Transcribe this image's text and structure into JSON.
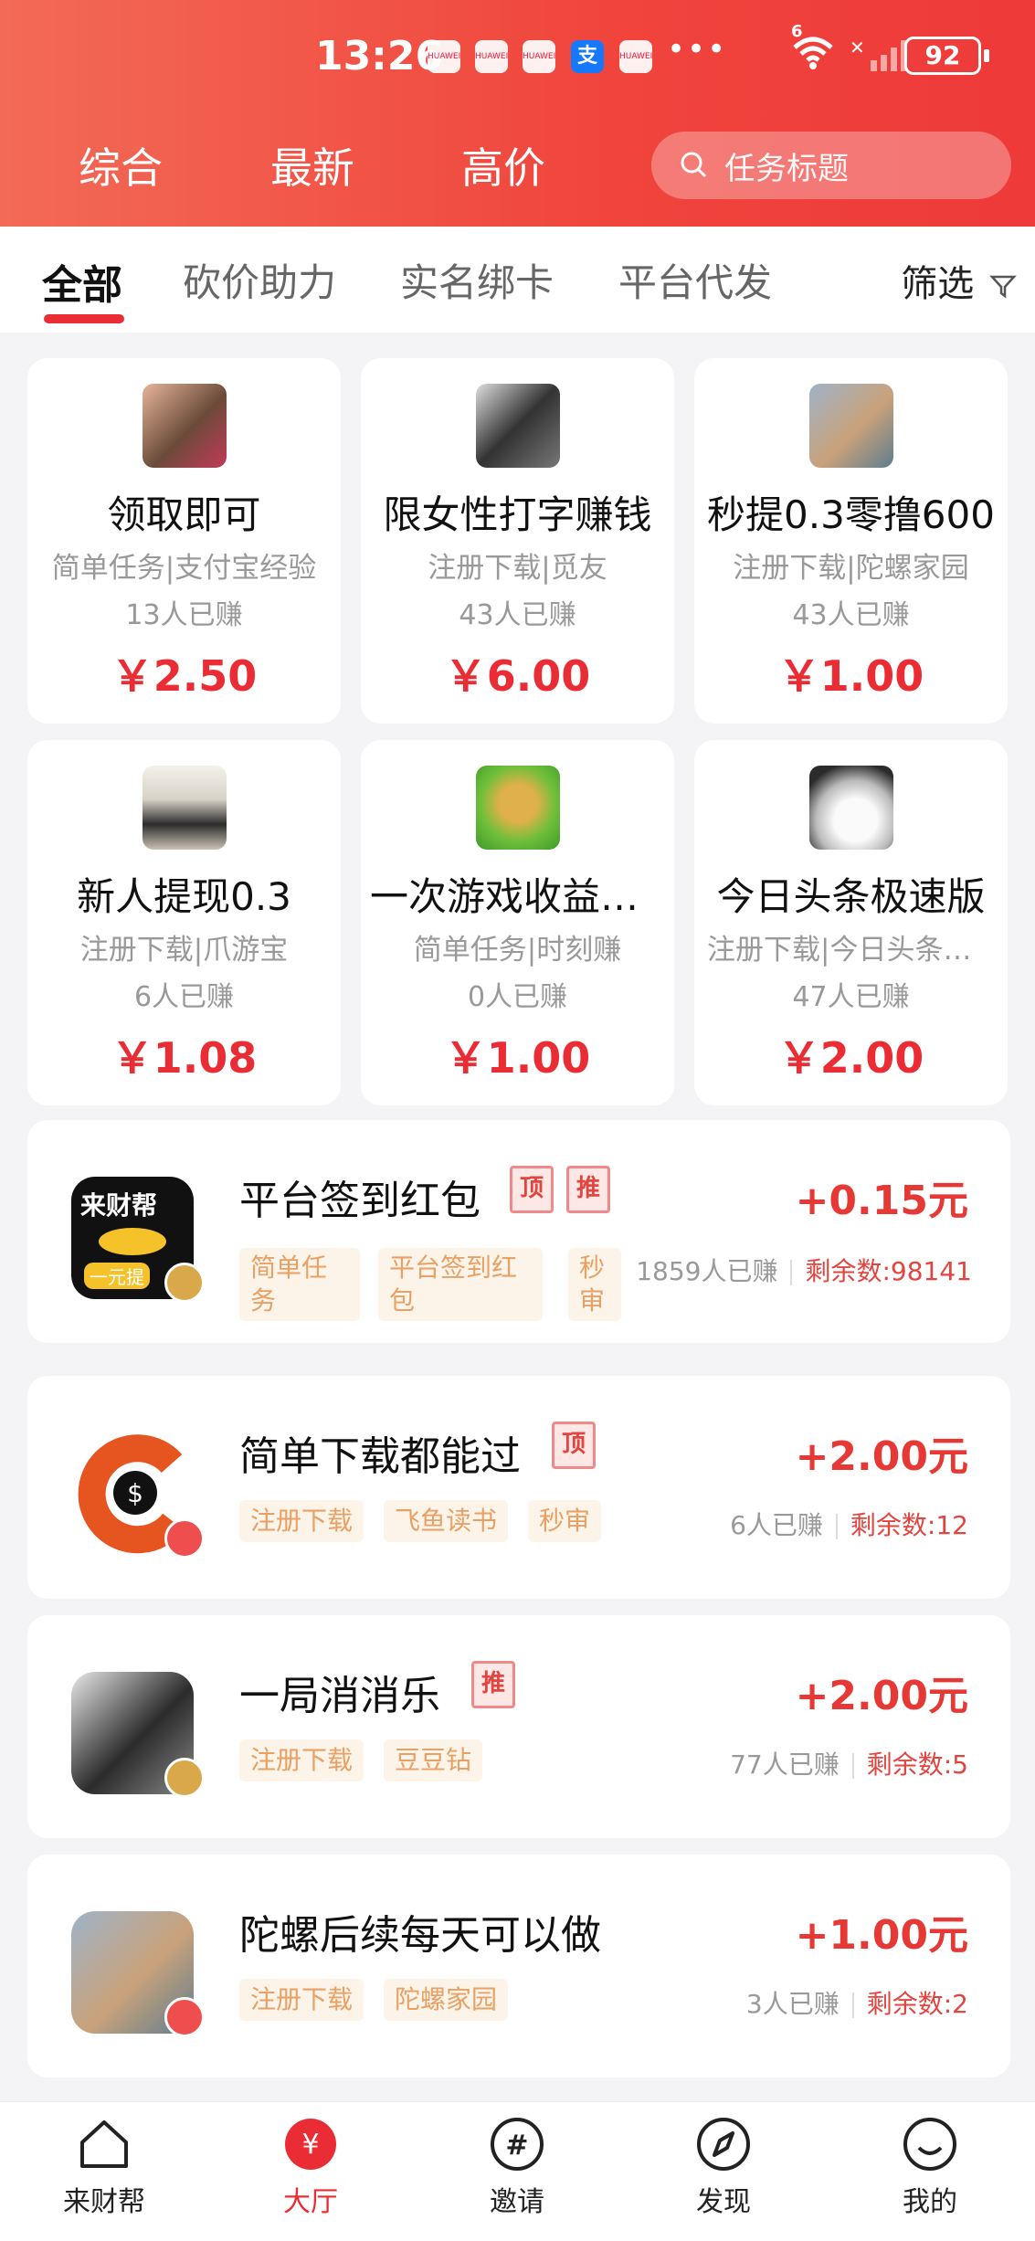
{
  "status_bar": {
    "time": "13:26",
    "battery": "92",
    "network": "6"
  },
  "top_tabs": [
    "综合",
    "最新",
    "高价"
  ],
  "search": {
    "placeholder": "任务标题"
  },
  "categories": [
    "全部",
    "砍价助力",
    "实名绑卡",
    "平台代发"
  ],
  "filter_label": "筛选",
  "grid_tasks": [
    {
      "title": "领取即可",
      "subtitle": "简单任务|支付宝经验",
      "count": "13人已赚",
      "price": "￥2.50"
    },
    {
      "title": "限女性打字赚钱",
      "subtitle": "注册下载|觅友",
      "count": "43人已赚",
      "price": "￥6.00"
    },
    {
      "title": "秒提0.3零撸600",
      "subtitle": "注册下载|陀螺家园",
      "count": "43人已赚",
      "price": "￥1.00"
    },
    {
      "title": "新人提现0.3",
      "subtitle": "注册下载|爪游宝",
      "count": "6人已赚",
      "price": "￥1.08"
    },
    {
      "title": "一次游戏收益百元",
      "subtitle": "简单任务|时刻赚",
      "count": "0人已赚",
      "price": "￥1.00"
    },
    {
      "title": "今日头条极速版",
      "subtitle": "注册下载|今日头条极速版",
      "count": "47人已赚",
      "price": "￥2.00"
    }
  ],
  "list_tasks": [
    {
      "title": "平台签到红包",
      "marks": [
        "顶",
        "推"
      ],
      "tags": [
        "简单任务",
        "平台签到红包",
        "秒审"
      ],
      "price": "+0.15元",
      "earned": "1859人已赚",
      "remaining": "剩余数:98141",
      "logo_text": "来财帮",
      "logo_sub": "一元提"
    },
    {
      "title": "简单下载都能过",
      "marks": [
        "顶"
      ],
      "tags": [
        "注册下载",
        "飞鱼读书",
        "秒审"
      ],
      "price": "+2.00元",
      "earned": "6人已赚",
      "remaining": "剩余数:12"
    },
    {
      "title": "一局消消乐",
      "marks": [
        "推"
      ],
      "tags": [
        "注册下载",
        "豆豆钻"
      ],
      "price": "+2.00元",
      "earned": "77人已赚",
      "remaining": "剩余数:5"
    },
    {
      "title": "陀螺后续每天可以做",
      "marks": [],
      "tags": [
        "注册下载",
        "陀螺家园"
      ],
      "price": "+1.00元",
      "earned": "3人已赚",
      "remaining": "剩余数:2"
    }
  ],
  "bottom_nav": [
    "来财帮",
    "大厅",
    "邀请",
    "发现",
    "我的"
  ],
  "colors": {
    "accent": "#ea2d34",
    "header_start": "#f36a56",
    "header_end": "#ee3a39",
    "tag_bg": "#fdf4e9",
    "tag_text": "#e8a064"
  }
}
